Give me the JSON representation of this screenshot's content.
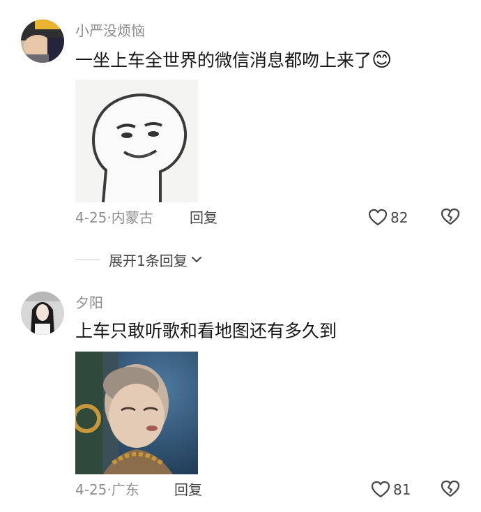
{
  "comments": [
    {
      "username": "小严没烦恼",
      "text": "一坐上车全世界的微信消息都吻上来了",
      "emoji": "😊",
      "date": "4-25",
      "location": "内蒙古",
      "reply_label": "回复",
      "like_count": "82",
      "image_icon": "meme-sticker-face"
    },
    {
      "username": "夕阳",
      "text": "上车只敢听歌和看地图还有多久到",
      "date": "4-25",
      "location": "广东",
      "reply_label": "回复",
      "like_count": "81",
      "image_icon": "tv-still-monk-photo"
    }
  ],
  "expand_replies": {
    "label": "展开1条回复"
  },
  "meta_separator": "·",
  "icons": [
    "heart-icon",
    "broken-heart-icon",
    "chevron-down-icon"
  ],
  "colors": {
    "username": "#8a8a8a",
    "meta": "#8e8e8e",
    "text": "#161616"
  }
}
